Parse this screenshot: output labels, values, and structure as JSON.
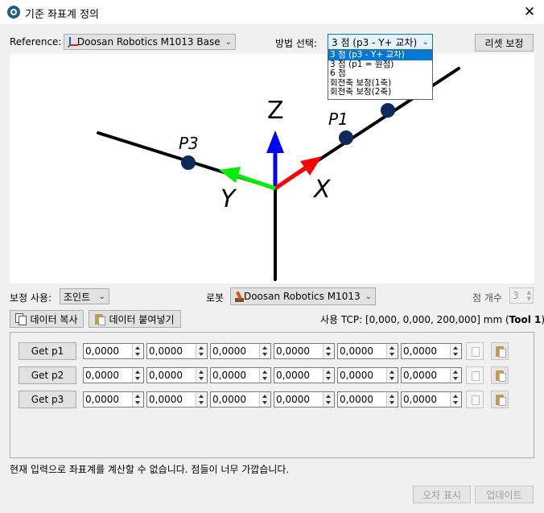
{
  "window": {
    "title": "기준 좌표계 정의",
    "close": "✕"
  },
  "reference": {
    "label": "Reference:",
    "value": "Doosan Robotics M1013 Base"
  },
  "method": {
    "label": "방법 선택:",
    "value": "3 점 (p3 - Y+ 교차)",
    "options": [
      "3 점 (p3 - Y+ 교차)",
      "3 점 (p1 = 원점)",
      "6 점",
      "회전축 보정(1축)",
      "회전축 보정(2축)"
    ],
    "selected_index": 0
  },
  "reset_button": "리셋 보정",
  "diagram": {
    "z": "Z",
    "x": "X",
    "y": "Y",
    "p1": "P1",
    "p3": "P3"
  },
  "calibration": {
    "label": "보정 사용:",
    "value": "조인트"
  },
  "robot": {
    "label": "로봇",
    "value": "Doosan Robotics M1013"
  },
  "point_count": {
    "label": "점 개수",
    "value": "3"
  },
  "copy_data": "데이터 복사",
  "paste_data": "데이터 붙여넣기",
  "tcp": {
    "prefix": "사용 TCP: [0,000, 0,000, 200,000] mm (",
    "tool": "Tool 1",
    "suffix": ")"
  },
  "rows": [
    {
      "button": "Get p1",
      "values": [
        "0,0000",
        "0,0000",
        "0,0000",
        "0,0000",
        "0,0000",
        "0,0000"
      ]
    },
    {
      "button": "Get p2",
      "values": [
        "0,0000",
        "0,0000",
        "0,0000",
        "0,0000",
        "0,0000",
        "0,0000"
      ]
    },
    {
      "button": "Get p3",
      "values": [
        "0,0000",
        "0,0000",
        "0,0000",
        "0,0000",
        "0,0000",
        "0,0000"
      ]
    }
  ],
  "status_message": "현재 입력으로 좌표계를 계산할 수 없습니다. 점들이 너무 가깝습니다.",
  "error_display_button": "오차 표시",
  "update_button": "업데이트",
  "colors": {
    "x_axis": "#ff0000",
    "y_axis": "#00ee00",
    "z_axis": "#0000ff",
    "point": "#0d2a5a",
    "selection": "#0078d7"
  }
}
